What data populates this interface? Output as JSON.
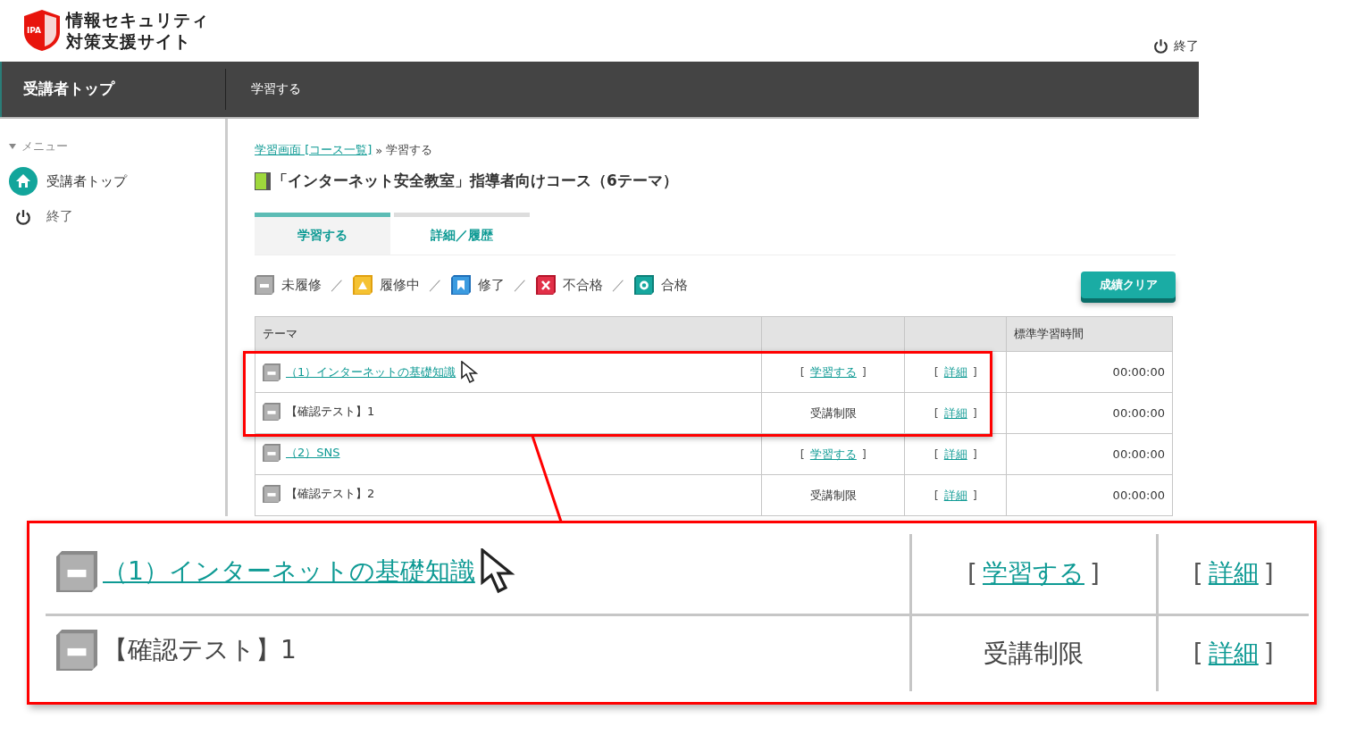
{
  "logo": {
    "badge": "IPA",
    "line1": "情報セキュリティ",
    "line2": "対策支援サイト"
  },
  "header_exit": "終了",
  "nav": [
    {
      "label": "受講者トップ",
      "selected": true
    },
    {
      "label": "学習する",
      "selected": false
    }
  ],
  "sidebar": {
    "heading": "メニュー",
    "items": [
      {
        "label": "受講者トップ",
        "kind": "home"
      },
      {
        "label": "終了",
        "kind": "power"
      }
    ]
  },
  "breadcrumb": {
    "link": "学習画面 [コース一覧]",
    "separator": "»",
    "current": "学習する"
  },
  "course_title": "「インターネット安全教室」指導者向けコース（6テーマ）",
  "tabs": [
    {
      "label": "学習する",
      "selected": true
    },
    {
      "label": "詳細／履歴",
      "selected": false
    }
  ],
  "legend": [
    {
      "label": "未履修",
      "kind": "not_started",
      "separator": "／"
    },
    {
      "label": "履修中",
      "kind": "in_progress",
      "separator": "／"
    },
    {
      "label": "修了",
      "kind": "completed",
      "separator": "／"
    },
    {
      "label": "不合格",
      "kind": "failed",
      "separator": "／"
    },
    {
      "label": "合格",
      "kind": "passed"
    }
  ],
  "clear_button": "成績クリア",
  "table": {
    "theme_header": "テーマ",
    "time_header": "標準学習時間",
    "rows": [
      {
        "title": "（1）インターネットの基礎知識",
        "title_link": true,
        "kind": "not_started",
        "action_open": "[",
        "action": "学習する",
        "action_close": "]",
        "action_link": true,
        "detail_open": "[",
        "detail": "詳細",
        "detail_close": "]",
        "time": "00:00:00",
        "pointer": true
      },
      {
        "title": "【確認テスト】1",
        "title_link": false,
        "kind": "not_started",
        "action": "受講制限",
        "action_link": false,
        "detail_open": "[",
        "detail": "詳細",
        "detail_close": "]",
        "time": "00:00:00",
        "pointer": false
      },
      {
        "title": "（2）SNS",
        "title_link": true,
        "kind": "not_started",
        "action_open": "[",
        "action": "学習する",
        "action_close": "]",
        "action_link": true,
        "detail_open": "[",
        "detail": "詳細",
        "detail_close": "]",
        "time": "00:00:00",
        "pointer": false
      },
      {
        "title": "【確認テスト】2",
        "title_link": false,
        "kind": "not_started",
        "action": "受講制限",
        "action_link": false,
        "detail_open": "[",
        "detail": "詳細",
        "detail_close": "]",
        "time": "00:00:00",
        "pointer": false
      }
    ]
  },
  "callout": {
    "rows": [
      {
        "title": "（1）インターネットの基礎知識",
        "title_link": true,
        "kind": "not_started",
        "action_open": "[",
        "action": "学習する",
        "action_close": "]",
        "action_link": true,
        "detail_open": "[",
        "detail": "詳細",
        "detail_close": "]",
        "pointer": true
      },
      {
        "title": "【確認テスト】1",
        "title_link": false,
        "kind": "not_started",
        "action": "受講制限",
        "action_link": false,
        "detail_open": "[",
        "detail": "詳細",
        "detail_close": "]",
        "pointer": false
      }
    ]
  }
}
